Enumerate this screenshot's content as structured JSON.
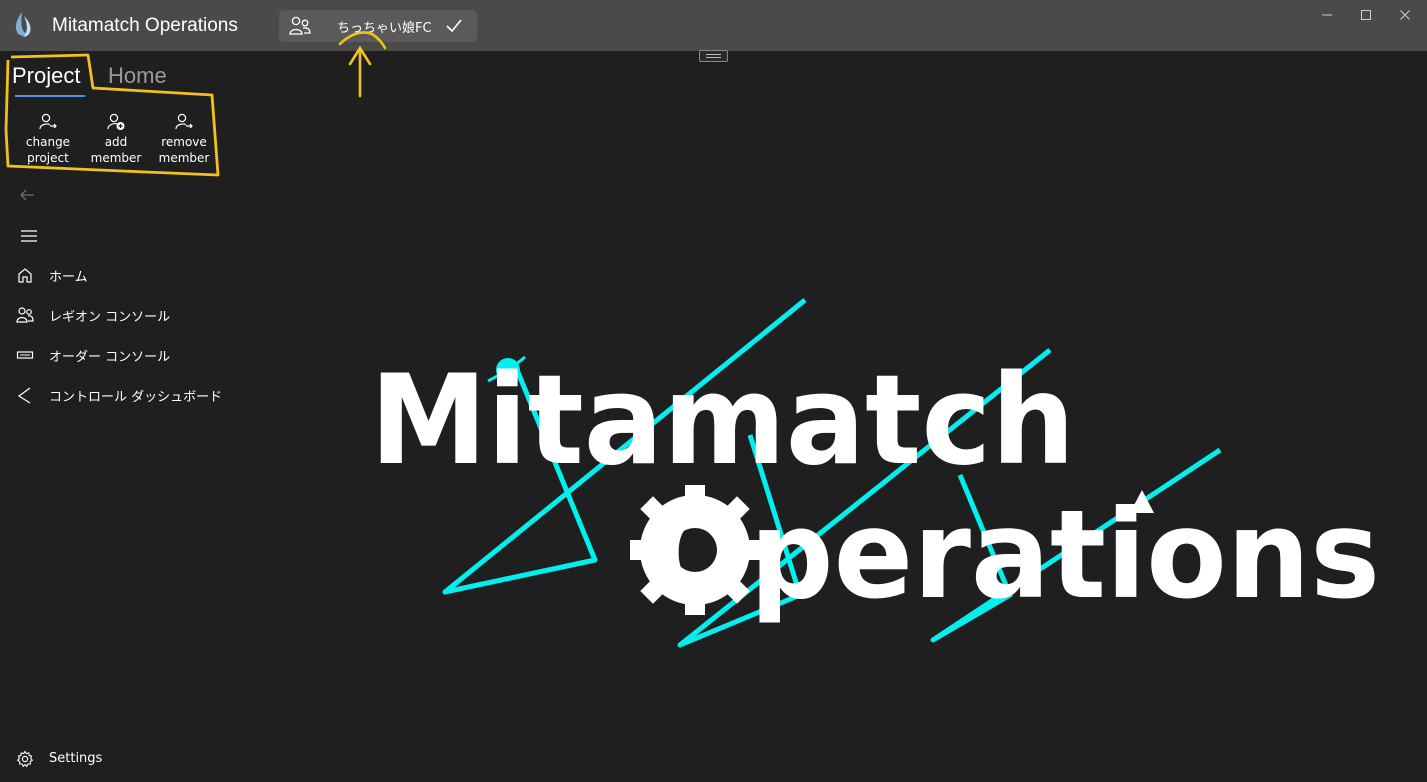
{
  "window": {
    "title": "Mitamatch Operations"
  },
  "project_selector": {
    "name": "ちっちゃい娘FC"
  },
  "ribbon": {
    "tabs": [
      {
        "label": "Project"
      },
      {
        "label": "Home"
      }
    ],
    "buttons": [
      {
        "label": "change\nproject"
      },
      {
        "label": "add\nmember"
      },
      {
        "label": "remove\nmember"
      }
    ]
  },
  "nav": {
    "items": [
      {
        "label": "ホーム"
      },
      {
        "label": "レギオン コンソール"
      },
      {
        "label": "オーダー コンソール"
      },
      {
        "label": "コントロール ダッシュボード"
      }
    ],
    "settings": {
      "label": "Settings"
    }
  },
  "logo": {
    "line1": "Mitamatch",
    "line2": "Operations"
  },
  "colors": {
    "accent": "#4f8fe8",
    "logo_cyan": "#00f0f0",
    "annotation": "#f2c21b",
    "titlebar": "#4a4a4a",
    "background": "#1f1f1f"
  },
  "icons": [
    "app-icon",
    "group-icon",
    "check-icon",
    "minimize-icon",
    "maximize-icon",
    "close-icon",
    "person-swap-icon",
    "person-add-icon",
    "person-remove-icon",
    "back-arrow-icon",
    "hamburger-menu-icon",
    "home-icon",
    "people-icon",
    "order-icon",
    "dashboard-icon",
    "gear-icon"
  ]
}
